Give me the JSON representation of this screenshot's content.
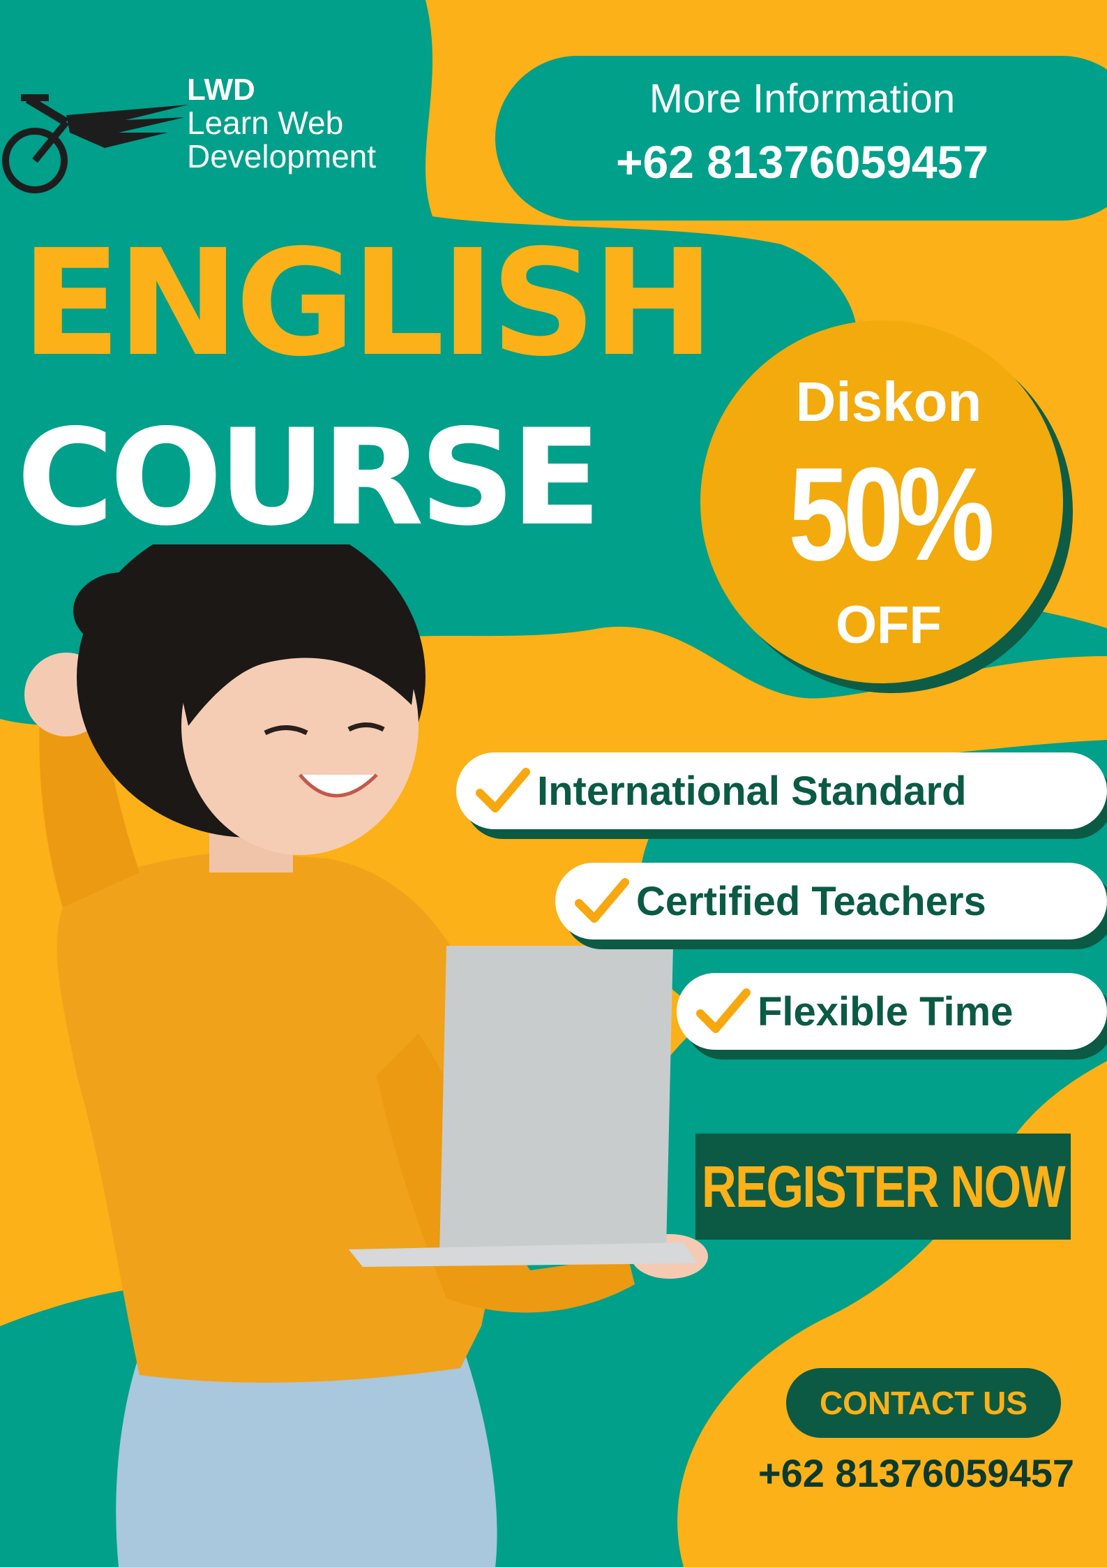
{
  "brand": {
    "abbr": "LWD",
    "name_line1": "Learn Web",
    "name_line2": "Development"
  },
  "info": {
    "label": "More Information",
    "phone": "+62 81376059457"
  },
  "headline": {
    "line1": "ENGLISH",
    "line2": "COURSE"
  },
  "discount": {
    "label": "Diskon",
    "value": "50%",
    "suffix": "OFF"
  },
  "features": [
    "International Standard",
    "Certified Teachers",
    "Flexible Time"
  ],
  "cta": {
    "register": "REGISTER NOW",
    "contact": "CONTACT US",
    "contact_phone": "+62 81376059457"
  },
  "colors": {
    "teal": "#00a08a",
    "yellow": "#fbb117",
    "dark_green": "#0b5a44",
    "orange_circle": "#f2aa0c"
  },
  "icons": [
    "bicycle-logo-icon",
    "check-icon"
  ]
}
